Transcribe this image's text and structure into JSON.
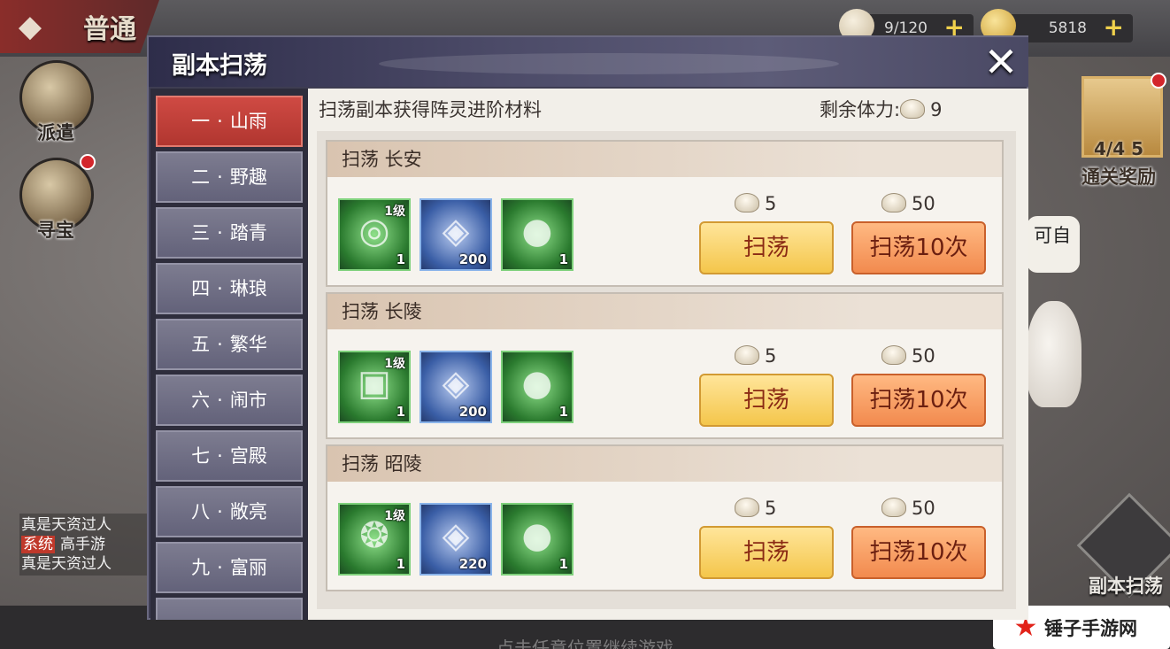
{
  "background": {
    "mode_title": "普通",
    "resources": [
      {
        "icon": "bun-icon",
        "value": "9/120"
      },
      {
        "icon": "gold-ingot-icon",
        "value": "5818"
      }
    ],
    "left_buttons": [
      {
        "label": "派遣",
        "icon": "scroll-icon"
      },
      {
        "label": "寻宝",
        "icon": "treasure-map-icon"
      }
    ],
    "chat": {
      "lines": [
        "真是天资过人",
        "真是天资过人"
      ],
      "system_tag": "系统",
      "system_text": "高手游"
    },
    "reward": {
      "count": "4/4",
      "extra": "5",
      "label": "通关奖励"
    },
    "bubble_text": "可自",
    "sweep_button_label": "副本扫荡",
    "continue_hint": "点击任意位置继续游戏",
    "site_label": "锤子手游网"
  },
  "dialog": {
    "title": "副本扫荡",
    "close_icon": "close-icon",
    "info_text": "扫荡副本获得阵灵进阶材料",
    "stamina_label": "剩余体力:",
    "stamina_value": "9",
    "chapters": [
      {
        "num": "一",
        "name": "山雨",
        "active": true
      },
      {
        "num": "二",
        "name": "野趣"
      },
      {
        "num": "三",
        "name": "踏青"
      },
      {
        "num": "四",
        "name": "琳琅"
      },
      {
        "num": "五",
        "name": "繁华"
      },
      {
        "num": "六",
        "name": "闹市"
      },
      {
        "num": "七",
        "name": "宫殿"
      },
      {
        "num": "八",
        "name": "敞亮"
      },
      {
        "num": "九",
        "name": "富丽"
      }
    ],
    "chapter_separator": "·",
    "rows": [
      {
        "title": "扫荡 长安",
        "items": [
          {
            "icon": "ring-artifact-icon",
            "level": "1级",
            "qty": "1"
          },
          {
            "icon": "coin-icon",
            "qty": "200"
          },
          {
            "icon": "jade-orb-icon",
            "qty": "1"
          }
        ],
        "cost_once": "5",
        "cost_ten": "50",
        "btn_once": "扫荡",
        "btn_ten": "扫荡10次"
      },
      {
        "title": "扫荡 长陵",
        "items": [
          {
            "icon": "seal-artifact-icon",
            "level": "1级",
            "qty": "1"
          },
          {
            "icon": "coin-icon",
            "qty": "200"
          },
          {
            "icon": "jade-orb-icon",
            "qty": "1"
          }
        ],
        "cost_once": "5",
        "cost_ten": "50",
        "btn_once": "扫荡",
        "btn_ten": "扫荡10次"
      },
      {
        "title": "扫荡 昭陵",
        "items": [
          {
            "icon": "jade-pendant-icon",
            "level": "1级",
            "qty": "1"
          },
          {
            "icon": "coin-icon",
            "qty": "220"
          },
          {
            "icon": "jade-orb-icon",
            "qty": "1"
          }
        ],
        "cost_once": "5",
        "cost_ten": "50",
        "btn_once": "扫荡",
        "btn_ten": "扫荡10次"
      }
    ]
  }
}
